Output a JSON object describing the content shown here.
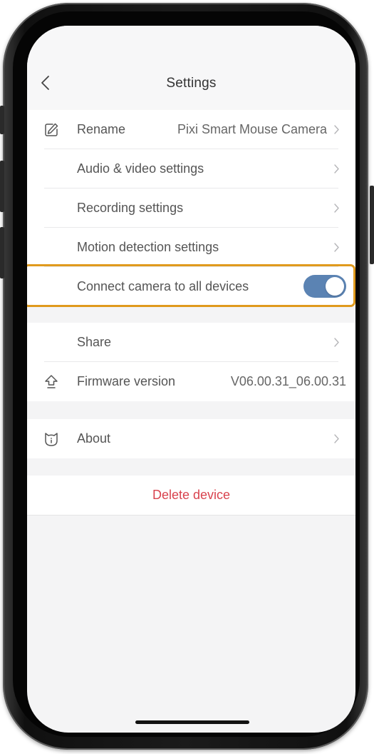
{
  "header": {
    "title": "Settings",
    "back_icon": "chevron-left-icon"
  },
  "settings": {
    "rename": {
      "label": "Rename",
      "value": "Pixi Smart Mouse Camera",
      "icon": "edit-pencil-icon"
    },
    "audio_video": {
      "label": "Audio & video settings"
    },
    "recording": {
      "label": "Recording settings"
    },
    "motion": {
      "label": "Motion detection settings"
    },
    "connect_all": {
      "label": "Connect camera to all devices",
      "enabled": true
    },
    "share": {
      "label": "Share"
    },
    "firmware": {
      "label": "Firmware version",
      "value": "V06.00.31_06.00.31",
      "icon": "upload-arrow-icon"
    },
    "about": {
      "label": "About",
      "icon": "cat-face-icon"
    }
  },
  "actions": {
    "delete_label": "Delete device"
  },
  "colors": {
    "toggle_on": "#5b83b3",
    "highlight": "#e09a1d",
    "danger": "#d9434e",
    "background": "#f4f4f5"
  }
}
